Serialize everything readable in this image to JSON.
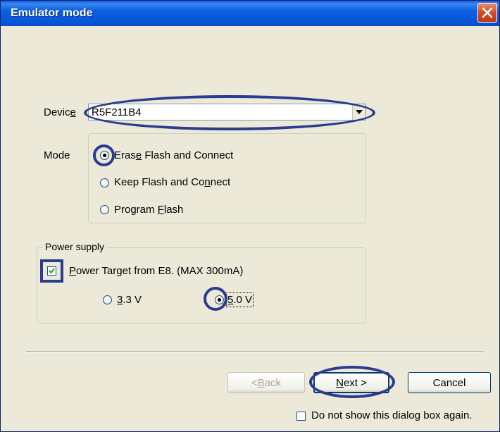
{
  "window": {
    "title": "Emulator mode"
  },
  "device": {
    "label_prefix": "Devic",
    "label_suffix": "e",
    "value": "R5F211B4"
  },
  "mode": {
    "label": "Mode",
    "options": [
      {
        "before": "Eras",
        "accel": "e",
        "after": " Flash and Connect",
        "selected": true
      },
      {
        "before": "Keep Flash and Co",
        "accel": "n",
        "after": "nect",
        "selected": false
      },
      {
        "before": "Program ",
        "accel": "F",
        "after": "lash",
        "selected": false
      }
    ]
  },
  "power": {
    "legend": "Power supply",
    "checkbox": {
      "accel": "P",
      "after": "ower Target from E8. (MAX 300mA)",
      "checked": true
    },
    "v33": {
      "accel": "3",
      "after": ".3 V",
      "selected": false
    },
    "v50": {
      "accel": "5",
      "after": ".0 V",
      "selected": true
    }
  },
  "buttons": {
    "back": {
      "pre": "< ",
      "accel": "B",
      "after": "ack",
      "enabled": false
    },
    "next": {
      "accel": "N",
      "after": "ext >"
    },
    "cancel": "Cancel"
  },
  "dont_show": {
    "label": "Do not show this dialog box again.",
    "checked": false
  },
  "colors": {
    "titlebar": "#0a5ae6",
    "highlight": "#2b3b8f",
    "dialog_bg": "#ece9d8"
  }
}
